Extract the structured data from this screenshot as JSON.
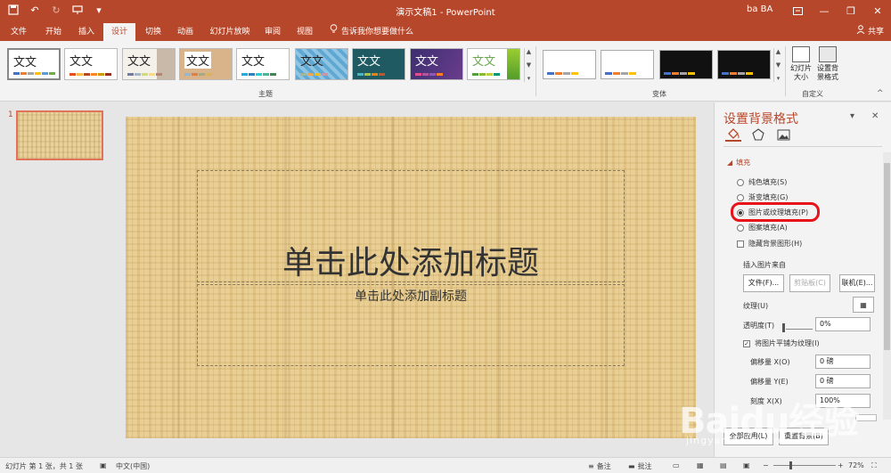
{
  "titlebar": {
    "title": "演示文稿1 - PowerPoint",
    "user": "ba BA",
    "qat": [
      "save-icon",
      "undo-icon",
      "redo-icon",
      "present-icon",
      "customize-icon"
    ],
    "window_buttons": [
      "ribbon-display-icon",
      "minimize-icon",
      "restore-icon",
      "close-icon"
    ]
  },
  "tabs": [
    {
      "label": "文件",
      "active": false
    },
    {
      "label": "开始",
      "active": false
    },
    {
      "label": "插入",
      "active": false
    },
    {
      "label": "设计",
      "active": true
    },
    {
      "label": "切换",
      "active": false
    },
    {
      "label": "动画",
      "active": false
    },
    {
      "label": "幻灯片放映",
      "active": false
    },
    {
      "label": "审阅",
      "active": false
    },
    {
      "label": "视图",
      "active": false
    }
  ],
  "tellme": "告诉我你想要做什么",
  "share": "共享",
  "ribbon": {
    "themes_label": "主题",
    "theme_sample_text": "文文",
    "variants_label": "变体",
    "customize_label": "自定义",
    "slide_size": "幻灯片大小",
    "format_background": "设置背景格式",
    "theme_colors": [
      "#ffffff",
      "#ffffff",
      "#f4f0ea",
      "#d9b48a",
      "#ffffff",
      "#5fa8d3",
      "#1f5a63",
      "#3b2f70",
      "#ffffff"
    ],
    "variant_colors": [
      "#ffffff",
      "#ffffff",
      "#111111",
      "#111111"
    ]
  },
  "thumbnail": {
    "number": "1"
  },
  "slide": {
    "title": "单击此处添加标题",
    "subtitle": "单击此处添加副标题"
  },
  "pane": {
    "title": "设置背景格式",
    "section": "填充",
    "options": [
      {
        "label": "纯色填充(S)",
        "selected": false
      },
      {
        "label": "渐变填充(G)",
        "selected": false
      },
      {
        "label": "图片或纹理填充(P)",
        "selected": true
      },
      {
        "label": "图案填充(A)",
        "selected": false
      }
    ],
    "hide_graphics": "隐藏背景图形(H)",
    "insert_from": "插入图片来自",
    "file_btn": "文件(F)...",
    "clipboard_btn": "剪贴板(C)",
    "online_btn": "联机(E)...",
    "texture_label": "纹理(U)",
    "transparency_label": "透明度(T)",
    "transparency_value": "0%",
    "tile_label": "将图片平铺为纹理(I)",
    "offset_x_label": "偏移量 X(O)",
    "offset_x_value": "0 磅",
    "offset_y_label": "偏移量 Y(E)",
    "offset_y_value": "0 磅",
    "scale_x_label": "刻度 X(X)",
    "scale_x_value": "100%",
    "apply_all": "全部应用(L)",
    "reset_bg": "重置背景(B)"
  },
  "status": {
    "slide_info": "幻灯片 第 1 张，共 1 张",
    "language": "中文(中国)",
    "notes": "备注",
    "comments": "批注",
    "zoom": "72%"
  },
  "watermark": {
    "main": "Baidu经验",
    "sub": "jingyan.baidu.com"
  }
}
